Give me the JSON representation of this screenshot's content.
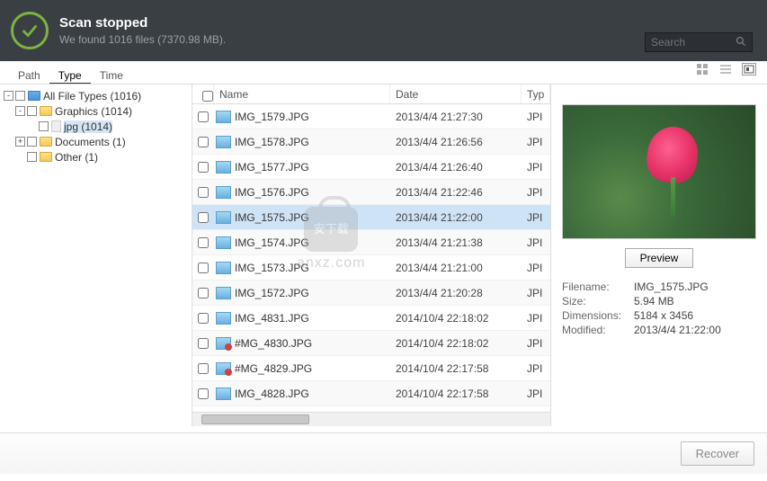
{
  "header": {
    "title": "Scan stopped",
    "subtitle": "We found 1016 files (7370.98 MB).",
    "search_placeholder": "Search"
  },
  "tabs": [
    "Path",
    "Type",
    "Time"
  ],
  "active_tab": 1,
  "tree": [
    {
      "level": 1,
      "toggle": "-",
      "icon": "blue",
      "label": "All File Types (1016)"
    },
    {
      "level": 2,
      "toggle": "-",
      "icon": "yellow",
      "label": "Graphics (1014)"
    },
    {
      "level": 3,
      "toggle": "",
      "icon": "file",
      "label": "jpg (1014)",
      "selected": true
    },
    {
      "level": 2,
      "toggle": "+",
      "icon": "yellow",
      "label": "Documents (1)"
    },
    {
      "level": 2,
      "toggle": "",
      "icon": "yellow",
      "label": "Other (1)"
    }
  ],
  "columns": {
    "check": "",
    "name": "Name",
    "date": "Date",
    "type": "Typ"
  },
  "rows": [
    {
      "name": "IMG_1579.JPG",
      "date": "2013/4/4 21:27:30",
      "type": "JPI",
      "icon": "img"
    },
    {
      "name": "IMG_1578.JPG",
      "date": "2013/4/4 21:26:56",
      "type": "JPI",
      "icon": "img"
    },
    {
      "name": "IMG_1577.JPG",
      "date": "2013/4/4 21:26:40",
      "type": "JPI",
      "icon": "img"
    },
    {
      "name": "IMG_1576.JPG",
      "date": "2013/4/4 21:22:46",
      "type": "JPI",
      "icon": "img"
    },
    {
      "name": "IMG_1575.JPG",
      "date": "2013/4/4 21:22:00",
      "type": "JPI",
      "icon": "img",
      "selected": true
    },
    {
      "name": "IMG_1574.JPG",
      "date": "2013/4/4 21:21:38",
      "type": "JPI",
      "icon": "img"
    },
    {
      "name": "IMG_1573.JPG",
      "date": "2013/4/4 21:21:00",
      "type": "JPI",
      "icon": "img"
    },
    {
      "name": "IMG_1572.JPG",
      "date": "2013/4/4 21:20:28",
      "type": "JPI",
      "icon": "img"
    },
    {
      "name": "IMG_4831.JPG",
      "date": "2014/10/4 22:18:02",
      "type": "JPI",
      "icon": "img"
    },
    {
      "name": "#MG_4830.JPG",
      "date": "2014/10/4 22:18:02",
      "type": "JPI",
      "icon": "special"
    },
    {
      "name": "#MG_4829.JPG",
      "date": "2014/10/4 22:17:58",
      "type": "JPI",
      "icon": "special"
    },
    {
      "name": "IMG_4828.JPG",
      "date": "2014/10/4 22:17:58",
      "type": "JPI",
      "icon": "img"
    }
  ],
  "preview": {
    "button": "Preview",
    "meta": [
      {
        "label": "Filename:",
        "value": "IMG_1575.JPG"
      },
      {
        "label": "Size:",
        "value": "5.94 MB"
      },
      {
        "label": "Dimensions:",
        "value": "5184 x 3456"
      },
      {
        "label": "Modified:",
        "value": "2013/4/4 21:22:00"
      }
    ]
  },
  "footer": {
    "recover": "Recover"
  },
  "watermark": "anxz.com"
}
